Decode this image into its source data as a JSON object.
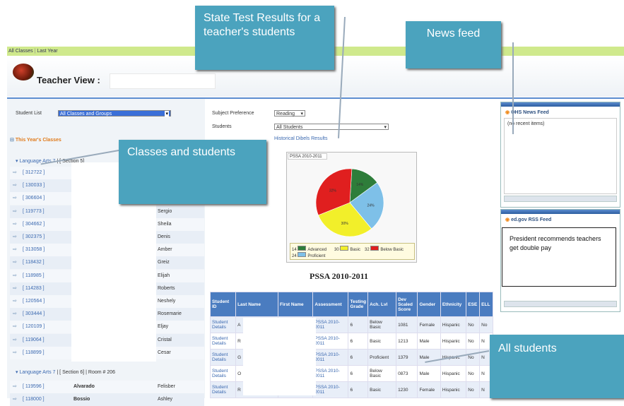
{
  "top_nav": {
    "items": [
      "All Classes",
      "Last Year"
    ]
  },
  "header": {
    "title": "Teacher View :"
  },
  "left": {
    "student_list_label": "Student List",
    "student_list_value": "All Classes and Groups",
    "section_title": "This Year's Classes",
    "class1": {
      "name": "Language Arts 7",
      "section": "| [ Section 5]"
    },
    "rows": [
      {
        "id": "[ 312722 ]",
        "name": ""
      },
      {
        "id": "[ 130033 ]",
        "name": ""
      },
      {
        "id": "[ 306604 ]",
        "name": ""
      },
      {
        "id": "[ 119773 ]",
        "name": "Sergio"
      },
      {
        "id": "[ 304662 ]",
        "name": "Sheila"
      },
      {
        "id": "[ 302375 ]",
        "name": "Denis"
      },
      {
        "id": "[ 313058 ]",
        "name": "Amber"
      },
      {
        "id": "[ 118432 ]",
        "name": "Greiz"
      },
      {
        "id": "[ 118985 ]",
        "name": "Elijah"
      },
      {
        "id": "[ 114283 ]",
        "name": "Roberts"
      },
      {
        "id": "[ 120564 ]",
        "name": "Neshely"
      },
      {
        "id": "[ 303444 ]",
        "name": "Rosemarie"
      },
      {
        "id": "[ 120109 ]",
        "name": "Eljay"
      },
      {
        "id": "[ 119064 ]",
        "name": "Cristal"
      },
      {
        "id": "[ 118899 ]",
        "name": "Cesar"
      }
    ],
    "class2": {
      "name": "Language Arts 7",
      "section": "| [ Section 6]",
      "room": "| Room # 206"
    },
    "rows2": [
      {
        "id": "[ 119596 ]",
        "last": "Alvarado",
        "name": "Felisber"
      },
      {
        "id": "[ 118000 ]",
        "last": "Bossio",
        "name": "Ashley"
      }
    ]
  },
  "middle": {
    "subject_label": "Subject Preference",
    "subject_value": "Reading",
    "students_label": "Students",
    "students_value": "All Students",
    "link": "Historical Dibels Results",
    "chart_tab": "PSSA 2010-2011",
    "chart_caption": "PSSA 2010-2011"
  },
  "chart_data": {
    "type": "pie",
    "title": "PSSA 2010-2011",
    "slices": [
      {
        "name": "Advanced",
        "count": 14,
        "pct": 14,
        "color": "#2e7d3a"
      },
      {
        "name": "Proficient",
        "count": 24,
        "pct": 24,
        "color": "#7ec0e8"
      },
      {
        "name": "Basic",
        "count": 30,
        "pct": 30,
        "color": "#f2ef2a"
      },
      {
        "name": "Below Basic",
        "count": 32,
        "pct": 32,
        "color": "#e01f1f"
      }
    ],
    "slice_labels": [
      "14%",
      "24%",
      "30%",
      "32%"
    ],
    "legend": [
      "14",
      "Advanced",
      "30",
      "Basic",
      "32",
      "Below Basic",
      "24",
      "Proficient"
    ]
  },
  "table": {
    "headers": [
      "Student ID",
      "Last Name",
      "First Name",
      "Assessment",
      "Testing Grade",
      "Ach. Lvl",
      "Dev Scaled Score",
      "Gender",
      "Ethnicity",
      "ESE",
      "ELL"
    ],
    "rows": [
      [
        "Student Details",
        "A",
        "",
        "PSSA 2010-2011",
        "6",
        "Below Basic",
        "1081",
        "Female",
        "Hispanic",
        "No",
        "No"
      ],
      [
        "Student Details",
        "R",
        "",
        "PSSA 2010-2011",
        "6",
        "Basic",
        "1213",
        "Male",
        "Hispanic",
        "No",
        "N"
      ],
      [
        "Student Details",
        "G",
        "",
        "PSSA 2010-2011",
        "6",
        "Proficient",
        "1379",
        "Male",
        "Hispanic",
        "No",
        "N"
      ],
      [
        "Student Details",
        "O",
        "",
        "PSSA 2010-2011",
        "6",
        "Below Basic",
        "0873",
        "Male",
        "Hispanic",
        "No",
        "N"
      ],
      [
        "Student Details",
        "R",
        "",
        "PSSA 2010-2011",
        "6",
        "Basic",
        "1230",
        "Female",
        "Hispanic",
        "No",
        "N"
      ]
    ]
  },
  "right": {
    "feed1_title": "OHS News Feed",
    "feed1_body": "(no recent items)",
    "feed2_title": "ed.gov RSS Feed"
  },
  "callouts": {
    "state_test": "State Test Results for a teacher's students",
    "news_feed": "News feed",
    "classes": "Classes and students",
    "all_students": "All students",
    "president": "President recommends teachers get double pay"
  }
}
